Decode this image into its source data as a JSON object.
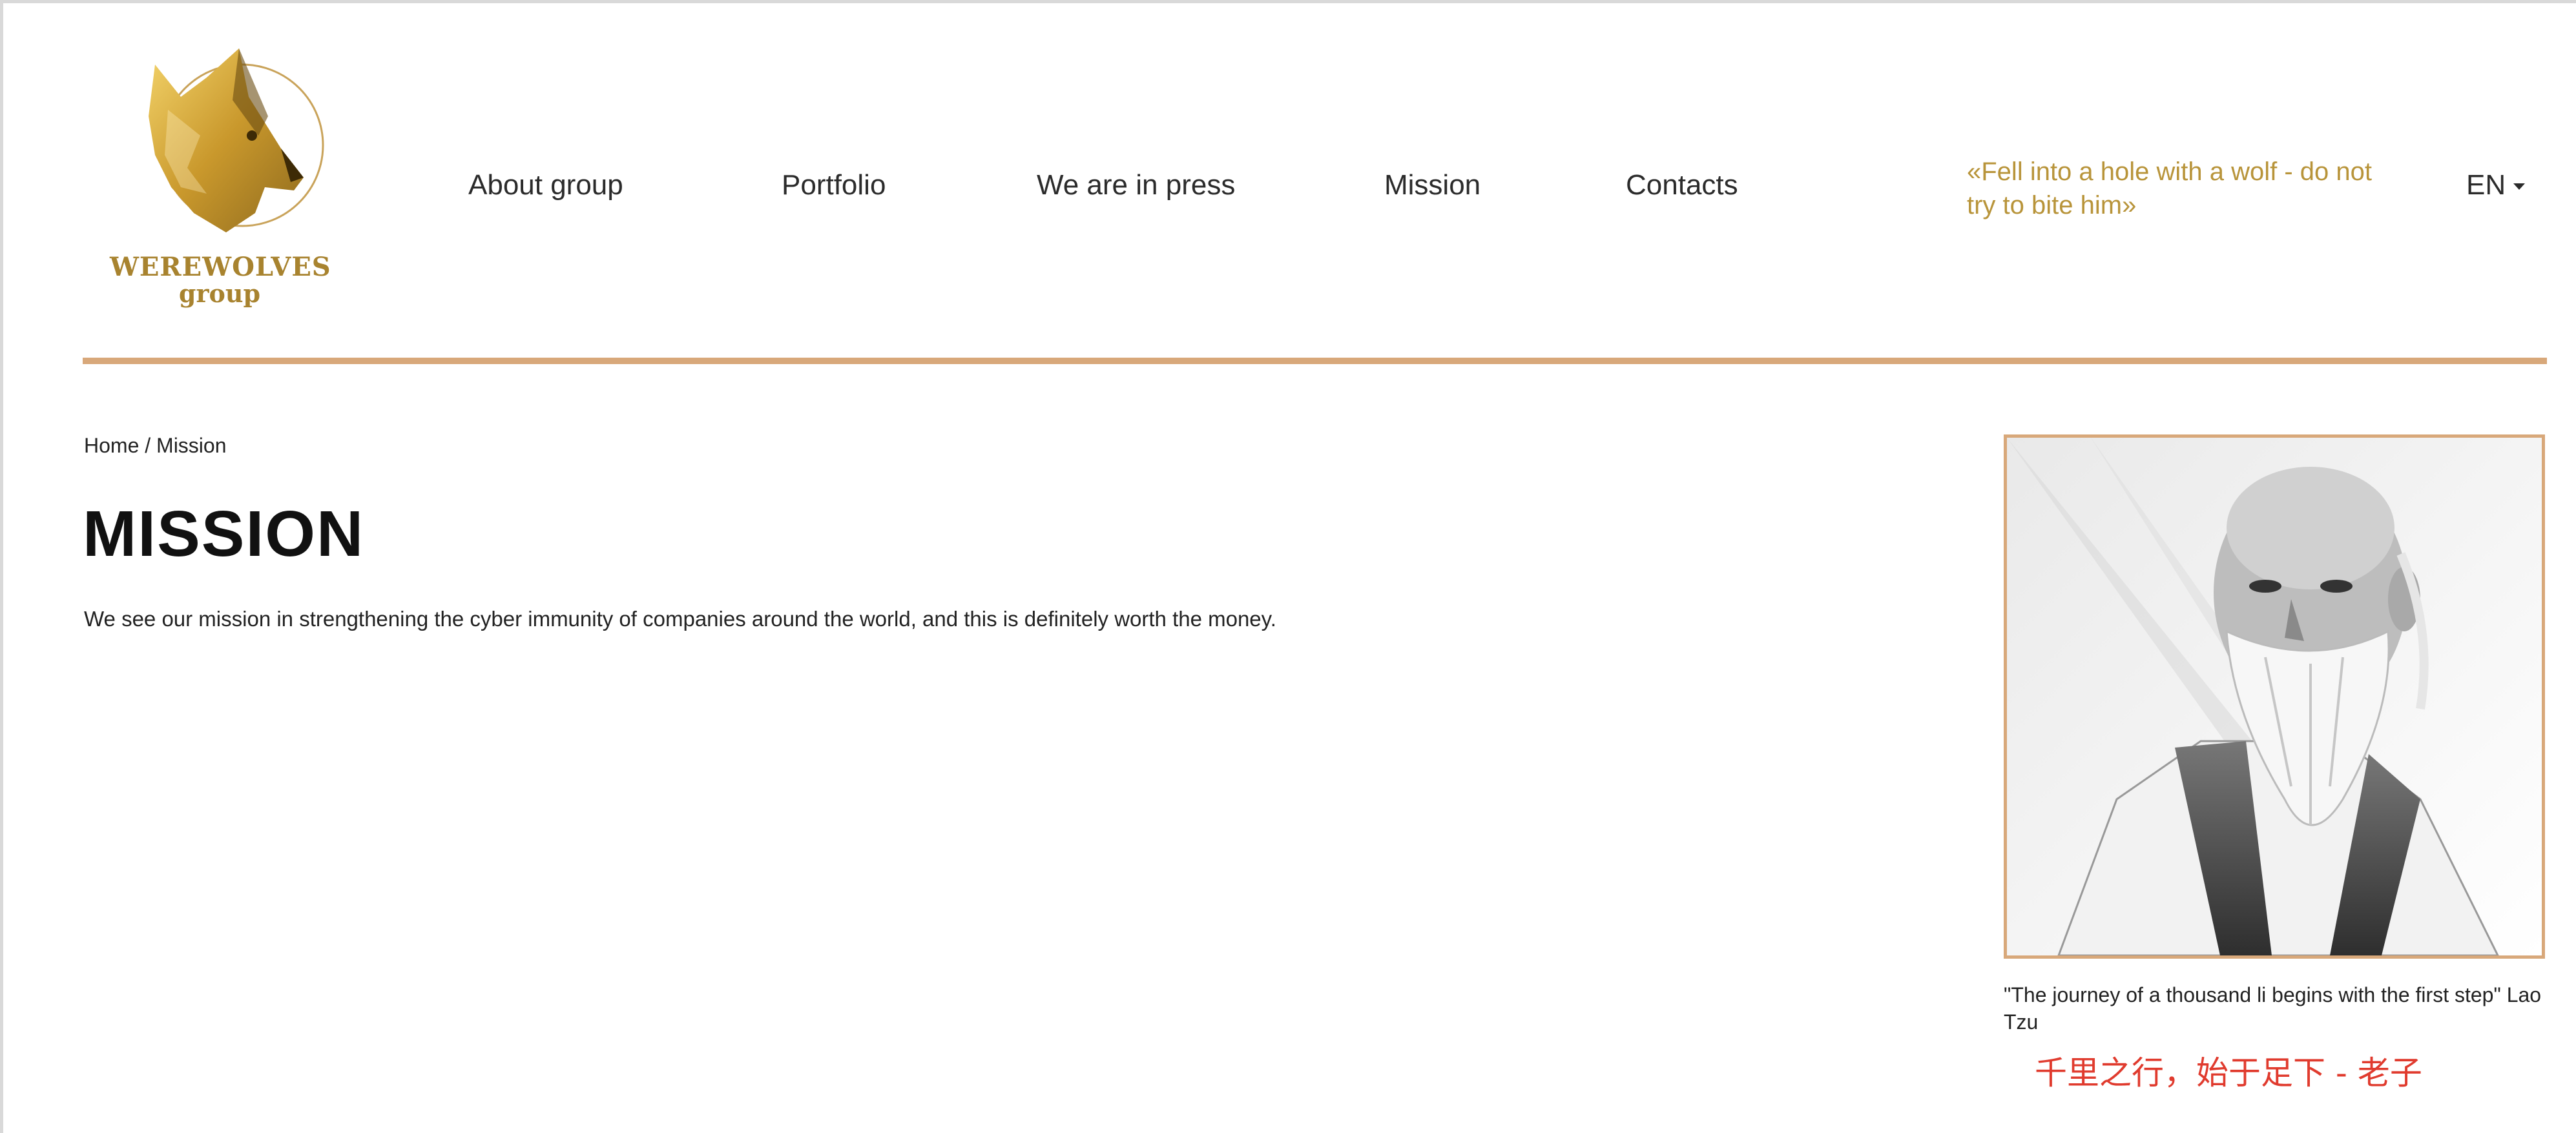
{
  "logo": {
    "name": "WEREWOLVES",
    "sub": "group"
  },
  "nav": {
    "items": [
      {
        "label": "About group"
      },
      {
        "label": "Portfolio"
      },
      {
        "label": "We are in press"
      },
      {
        "label": "Mission"
      },
      {
        "label": "Contacts"
      }
    ]
  },
  "header": {
    "motto": "«Fell into a hole with a wolf - do not try to bite him»",
    "language": "EN"
  },
  "colors": {
    "accent_gold": "#b8943a",
    "rule": "#d8a87a",
    "chinese_quote": "#e03b2e"
  },
  "breadcrumb": {
    "home": "Home",
    "separator": " / ",
    "current": "Mission"
  },
  "page": {
    "title": "MISSION",
    "text": "We see our mission in strengthening the cyber immunity of companies around the world, and this is definitely worth the money."
  },
  "portrait": {
    "caption": "\"The journey of a thousand li begins with the first step\" Lao Tzu",
    "caption_cn": "千里之行，始于足下 - 老子"
  }
}
